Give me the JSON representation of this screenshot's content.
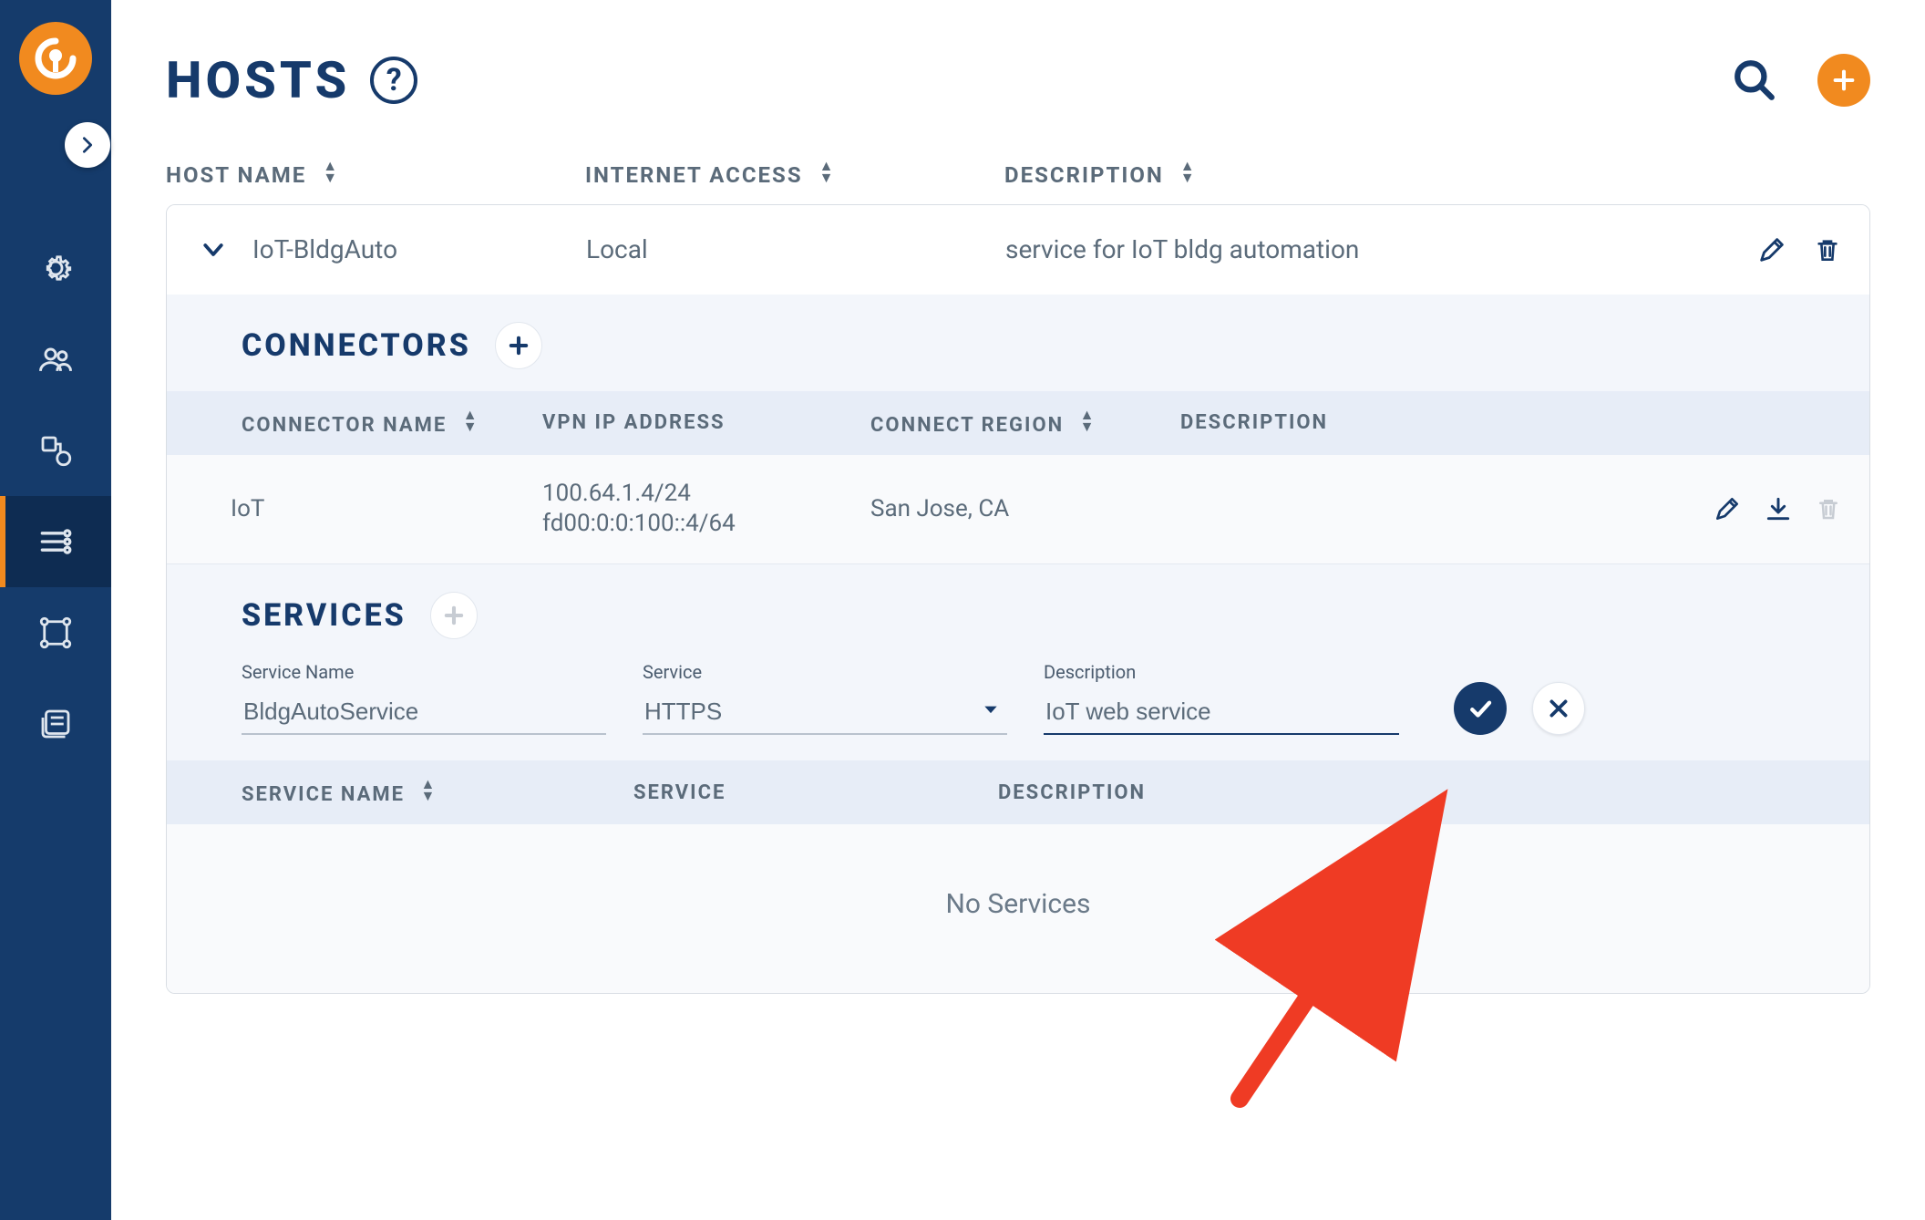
{
  "page": {
    "title": "HOSTS"
  },
  "columns": {
    "host_name": "HOST NAME",
    "internet_access": "INTERNET ACCESS",
    "description": "DESCRIPTION"
  },
  "host": {
    "name": "IoT-BldgAuto",
    "internet_access": "Local",
    "description": "service for IoT bldg automation"
  },
  "connectors": {
    "title": "CONNECTORS",
    "columns": {
      "name": "CONNECTOR NAME",
      "vpn_ip": "VPN IP ADDRESS",
      "region": "CONNECT REGION",
      "description": "DESCRIPTION"
    },
    "rows": [
      {
        "name": "IoT",
        "vpn_ip_v4": "100.64.1.4/24",
        "vpn_ip_v6": "fd00:0:0:100::4/64",
        "region": "San Jose, CA",
        "description": ""
      }
    ]
  },
  "services": {
    "title": "SERVICES",
    "form": {
      "name_label": "Service Name",
      "name_value": "BldgAutoService",
      "service_label": "Service",
      "service_value": "HTTPS",
      "desc_label": "Description",
      "desc_value": "IoT web service"
    },
    "columns": {
      "name": "SERVICE NAME",
      "service": "SERVICE",
      "description": "DESCRIPTION"
    },
    "empty": "No Services"
  },
  "colors": {
    "brand_navy": "#163a6b",
    "brand_orange": "#f18a1f",
    "panel_blue": "#e7edf7",
    "panel_light": "#f3f6fb"
  }
}
